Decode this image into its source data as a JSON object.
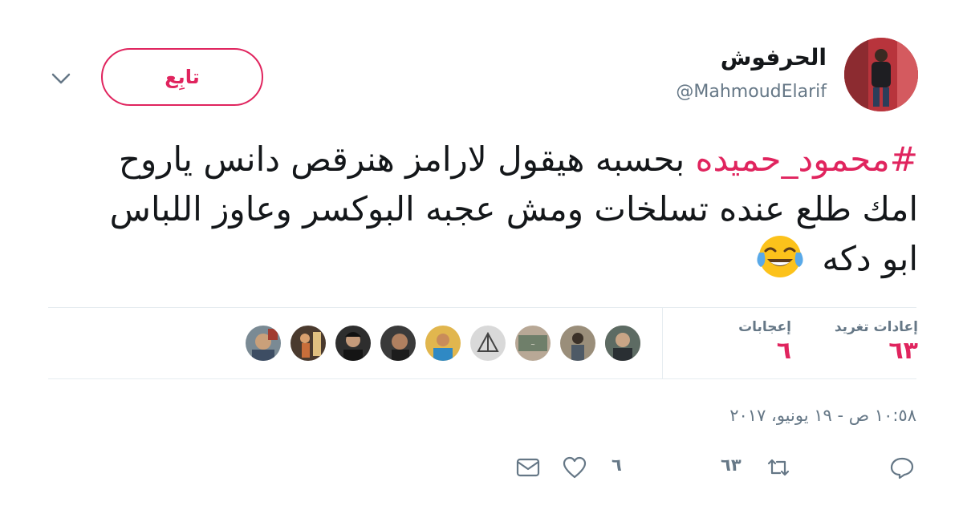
{
  "user": {
    "display_name": "الحرفوش",
    "handle": "@MahmoudElarif"
  },
  "follow_label": "تابِع",
  "tweet": {
    "hashtag": "#محمود_حميده",
    "body": " بحسبه هيقول لارامز هنرقص دانس ياروح امك طلع عنده تسلخات ومش عجبه البوكسر وعاوز اللباس ابو دكه",
    "emoji": "face-with-tears-of-joy"
  },
  "stats": {
    "retweets_label": "إعادات تغريد",
    "retweets_value": "٦٣",
    "likes_label": "إعجابات",
    "likes_value": "٦"
  },
  "likers_count": 9,
  "timestamp": "١٠:٥٨ ص - ١٩ يونيو، ٢٠١٧",
  "actions": {
    "retweet_count": "٦٣",
    "like_count": "٦"
  },
  "colors": {
    "accent": "#e0245e",
    "muted": "#657786",
    "text": "#14171a",
    "divider": "#e6ecf0"
  }
}
